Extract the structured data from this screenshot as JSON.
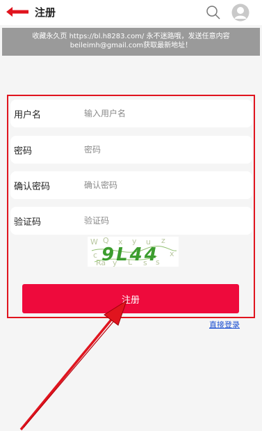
{
  "header": {
    "title": "注册",
    "back_icon": "back-arrow-icon",
    "search_icon": "search-icon",
    "avatar_icon": "user-avatar-icon",
    "accent_color": "#e0141e"
  },
  "notice": {
    "line1": "收藏永久页 https://bl.h8283.com/ 永不迷路哦，发送任意内容",
    "line2": "beileimh@gmail.com获取最新地址！"
  },
  "form": {
    "fields": [
      {
        "label": "用户名",
        "placeholder": "输入用户名"
      },
      {
        "label": "密码",
        "placeholder": "密码"
      },
      {
        "label": "确认密码",
        "placeholder": "确认密码"
      },
      {
        "label": "验证码",
        "placeholder": "验证码"
      }
    ],
    "captcha_text": "9L44",
    "submit_label": "注册",
    "submit_color": "#ee0a3c",
    "login_link": "直接登录"
  }
}
